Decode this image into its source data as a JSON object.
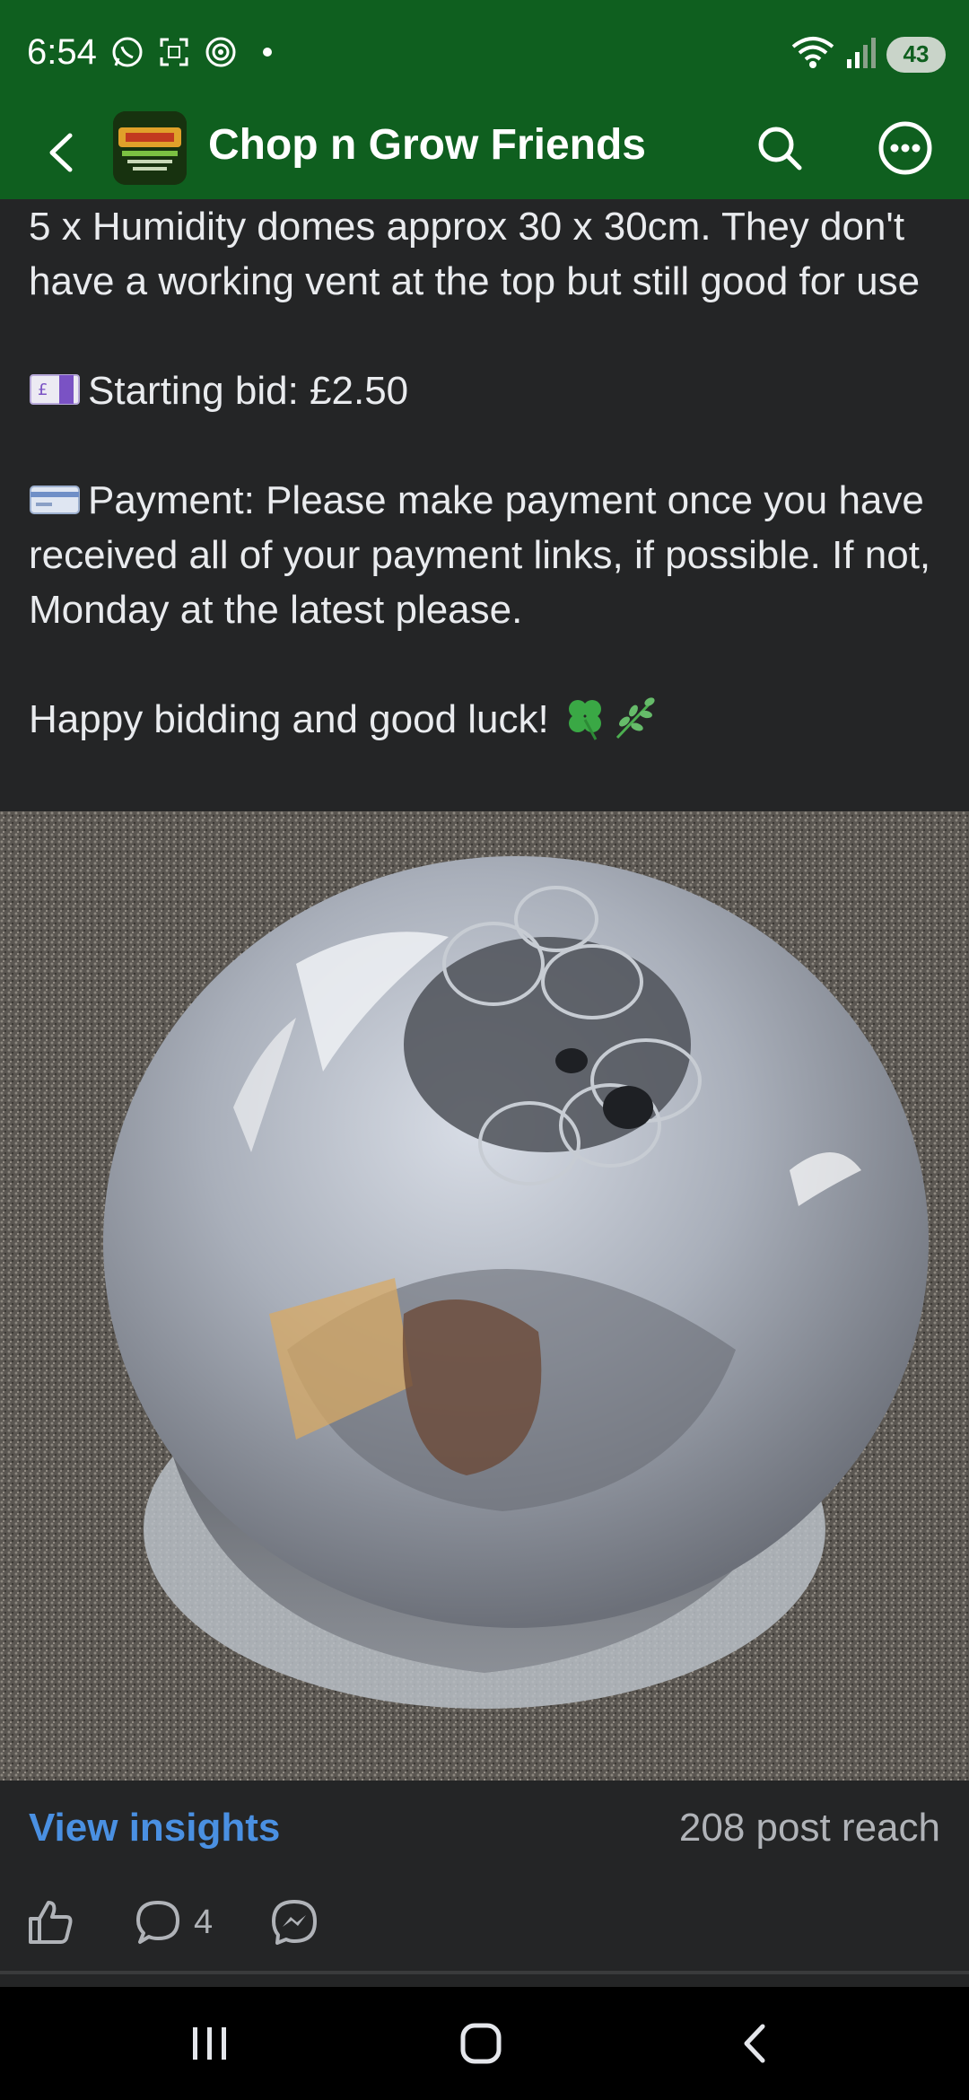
{
  "status_bar": {
    "time": "6:54",
    "battery": "43",
    "icons": [
      "whatsapp-icon",
      "screenshot-icon",
      "hotspot-icon",
      "wifi-icon",
      "signal-icon",
      "battery-icon"
    ],
    "background": "#0f5f1f"
  },
  "app_bar": {
    "title": "Chop n Grow Friends",
    "icons": [
      "back-arrow-icon",
      "search-icon",
      "more-icon"
    ],
    "background": "#0f5f1f"
  },
  "post": {
    "paragraph_1": "5 x Humidity domes approx 30 x 30cm. They don't have a working vent at the top but still good for use",
    "starting_bid": "Starting bid: £2.50",
    "payment": "Payment: Please make payment once you have received all of your payment links, if possible. If not, Monday at the latest please.",
    "closing": "Happy bidding and good luck!",
    "emojis": [
      "money-with-wings-icon",
      "credit-card-icon",
      "clover-icon",
      "herb-icon"
    ]
  },
  "footer": {
    "view_insights": "View insights",
    "post_reach": "208 post reach",
    "comment_count": "4",
    "accent": "#4a90e2"
  },
  "nav": {
    "icons": [
      "recents-icon",
      "home-icon",
      "back-icon"
    ]
  }
}
